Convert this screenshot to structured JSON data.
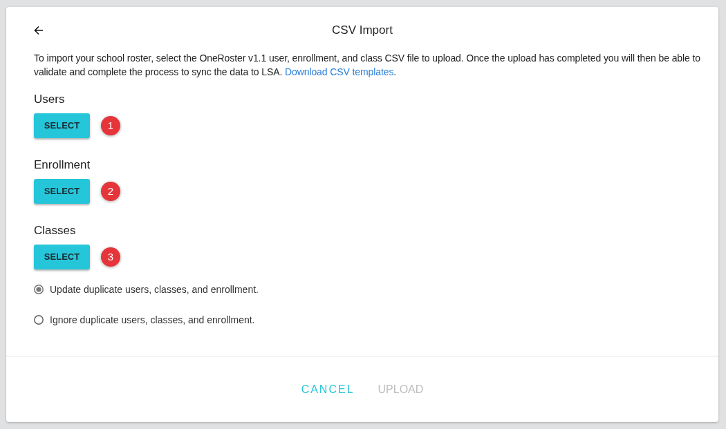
{
  "dialog": {
    "title": "CSV Import",
    "description": "To import your school roster, select the OneRoster v1.1 user, enrollment, and class CSV file to upload. Once the upload has completed you will then be able to validate and complete the process to sync the data to LSA. ",
    "link": "Download CSV templates",
    "description_end": "."
  },
  "files": [
    {
      "label": "Users",
      "button": "SELECT",
      "step": "1"
    },
    {
      "label": "Enrollment",
      "button": "SELECT",
      "step": "2"
    },
    {
      "label": "Classes",
      "button": "SELECT",
      "step": "3"
    }
  ],
  "options": [
    {
      "label": "Update duplicate users, classes, and enrollment.",
      "selected": true
    },
    {
      "label": "Ignore duplicate users, classes, and enrollment.",
      "selected": false
    }
  ],
  "footer": [
    {
      "label": "CANCEL",
      "disabled": false
    },
    {
      "label": "UPLOAD",
      "disabled": true
    }
  ]
}
